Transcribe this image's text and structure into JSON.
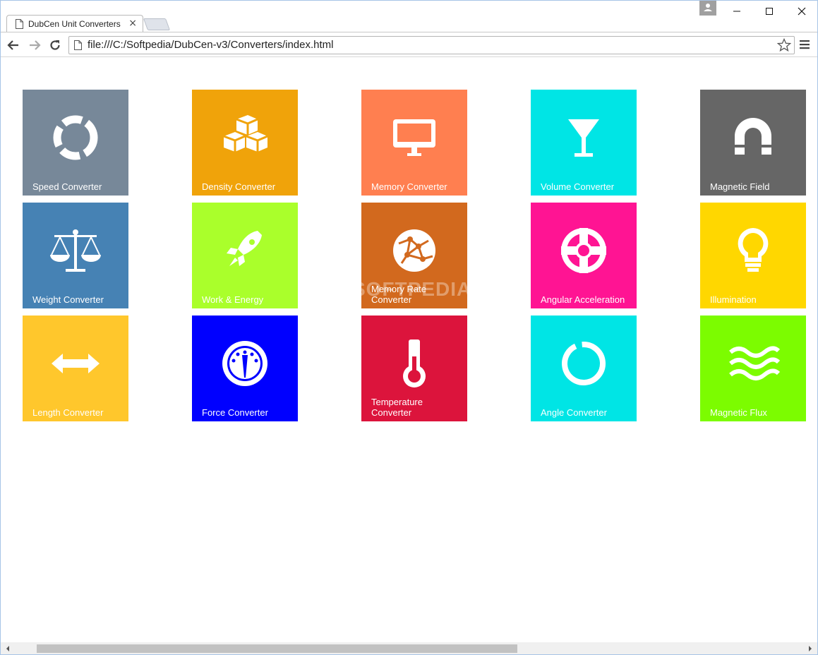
{
  "browser": {
    "tab_title": "DubCen Unit Converters",
    "tab_close": "×",
    "url": "file:///C:/Softpedia/DubCen-v3/Converters/index.html"
  },
  "tiles": [
    {
      "label": "Speed Converter",
      "color": "#778899",
      "icon": "lifebuoy-ring-icon"
    },
    {
      "label": "Density Converter",
      "color": "#F0A30A",
      "icon": "cubes-icon"
    },
    {
      "label": "Memory Converter",
      "color": "#FF7F50",
      "icon": "monitor-icon"
    },
    {
      "label": "Volume Converter",
      "color": "#00E5E5",
      "icon": "glass-icon"
    },
    {
      "label": "Magnetic Field",
      "color": "#666666",
      "icon": "magnet-icon"
    },
    {
      "label": "Weight Converter",
      "color": "#4682B4",
      "icon": "scale-icon"
    },
    {
      "label": "Work & Energy",
      "color": "#AAFF2B",
      "icon": "rocket-icon"
    },
    {
      "label": "Memory Rate Converter",
      "color": "#D2691E",
      "icon": "globe-network-icon"
    },
    {
      "label": "Angular Acceleration",
      "color": "#FF1493",
      "icon": "lifebuoy-icon"
    },
    {
      "label": "Illumination",
      "color": "#FFD700",
      "icon": "lightbulb-icon"
    },
    {
      "label": "Length Converter",
      "color": "#FFC72C",
      "icon": "double-arrow-icon"
    },
    {
      "label": "Force Converter",
      "color": "#0000FF",
      "icon": "gauge-icon"
    },
    {
      "label": "Temperature Converter",
      "color": "#DC143C",
      "icon": "thermometer-icon"
    },
    {
      "label": "Angle Converter",
      "color": "#00E5E5",
      "icon": "ring-icon"
    },
    {
      "label": "Magnetic Flux",
      "color": "#7CFC00",
      "icon": "waves-icon"
    }
  ],
  "watermark": "SOFTPEDIA"
}
